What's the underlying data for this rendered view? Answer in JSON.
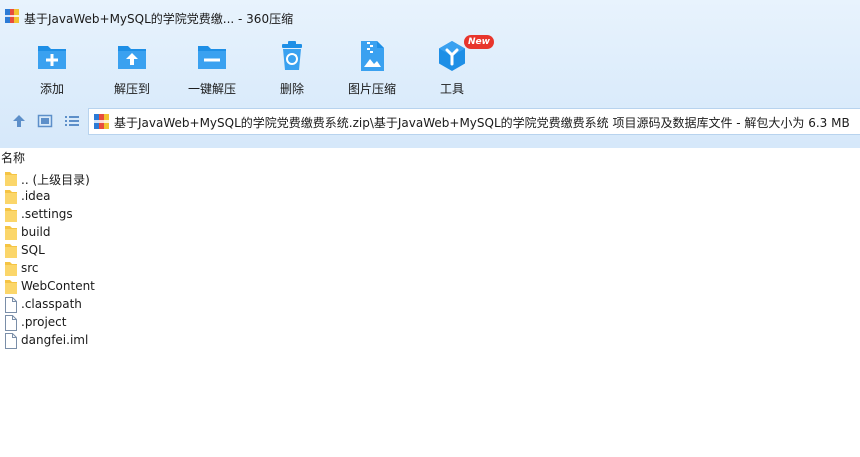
{
  "window": {
    "title": "基于JavaWeb+MySQL的学院党费缴... - 360压缩"
  },
  "toolbar": {
    "items": [
      {
        "label": "添加",
        "icon": "add-archive-icon"
      },
      {
        "label": "解压到",
        "icon": "extract-to-icon"
      },
      {
        "label": "一键解压",
        "icon": "one-click-extract-icon"
      },
      {
        "label": "删除",
        "icon": "recycle-delete-icon"
      },
      {
        "label": "图片压缩",
        "icon": "image-compress-icon"
      },
      {
        "label": "工具",
        "icon": "tools-icon",
        "badge": "New"
      }
    ]
  },
  "address": {
    "path": "基于JavaWeb+MySQL的学院党费缴费系统.zip\\基于JavaWeb+MySQL的学院党费缴费系统 项目源码及数据库文件 - 解包大小为 6.3 MB"
  },
  "list": {
    "column_name": "名称",
    "items": [
      {
        "name": ".. (上级目录)",
        "type": "folder"
      },
      {
        "name": ".idea",
        "type": "folder"
      },
      {
        "name": ".settings",
        "type": "folder"
      },
      {
        "name": "build",
        "type": "folder"
      },
      {
        "name": "SQL",
        "type": "folder"
      },
      {
        "name": "src",
        "type": "folder"
      },
      {
        "name": "WebContent",
        "type": "folder"
      },
      {
        "name": ".classpath",
        "type": "file"
      },
      {
        "name": ".project",
        "type": "file"
      },
      {
        "name": "dangfei.iml",
        "type": "file"
      }
    ]
  },
  "colors": {
    "accent": "#1e8fe6",
    "folder": "#f5c444",
    "badge": "#e8352c"
  }
}
